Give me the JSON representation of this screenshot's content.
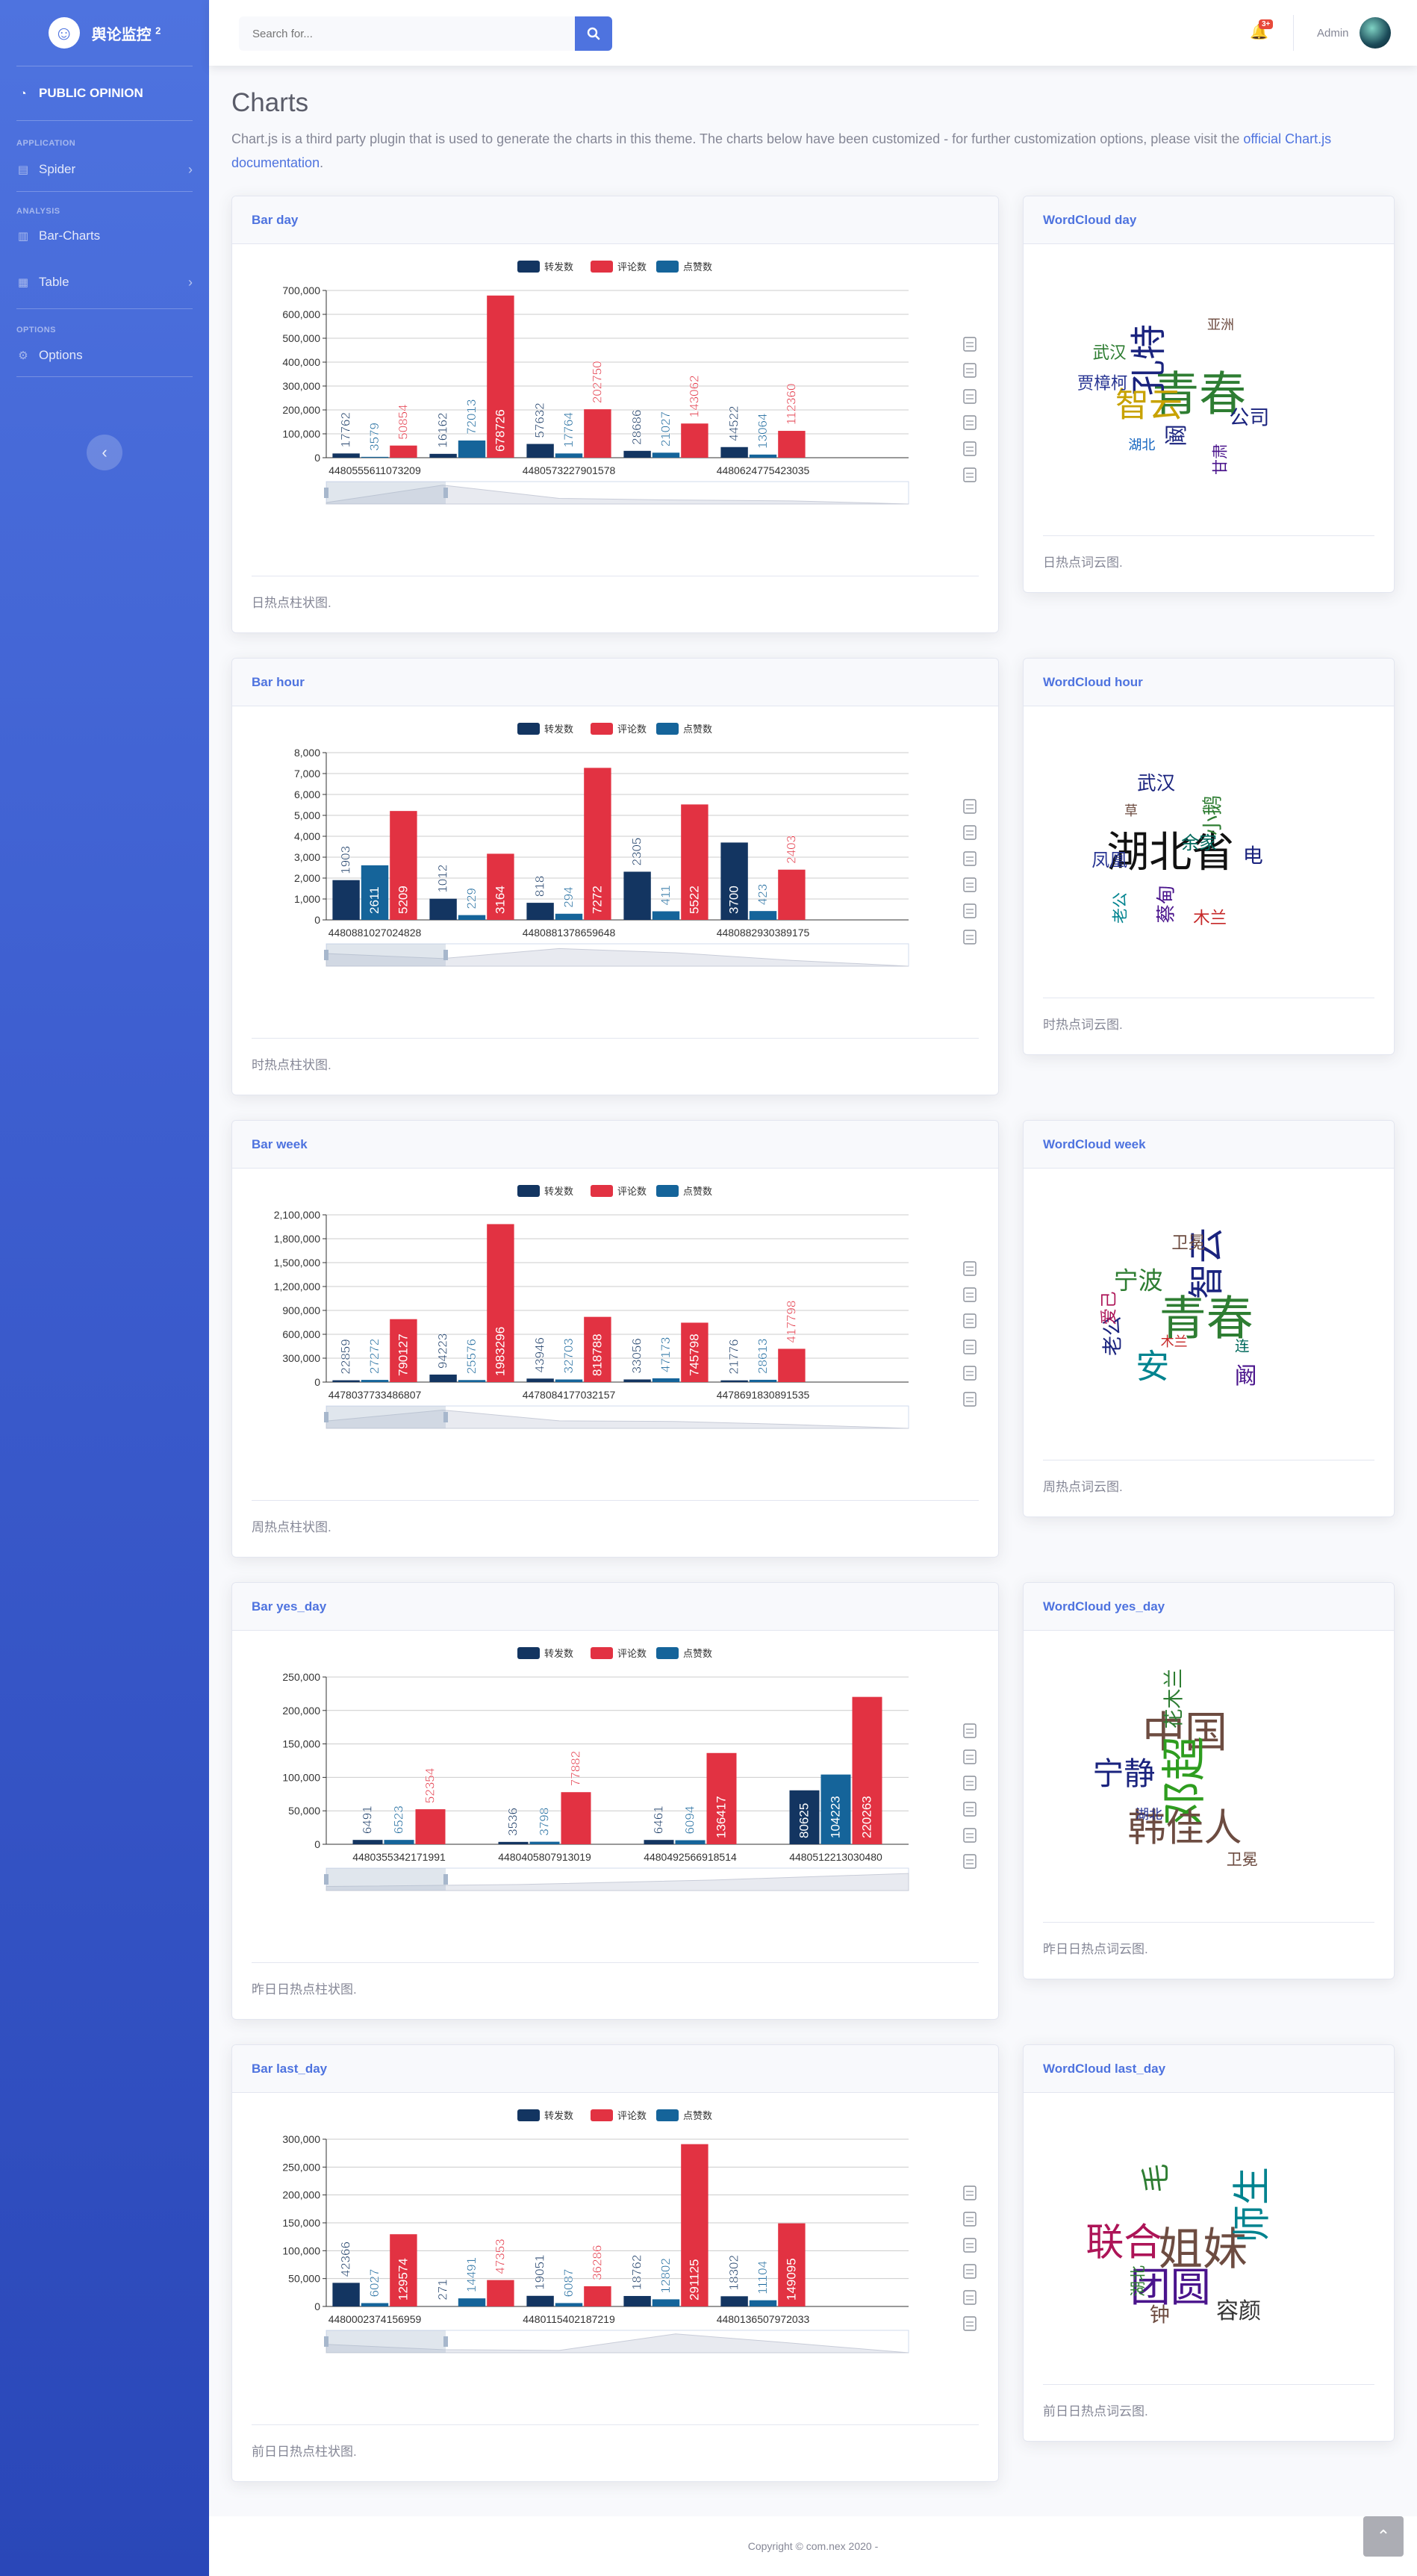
{
  "sidebar": {
    "brand": "舆论监控",
    "brand_sup": "2",
    "dashboard": "PUBLIC OPINION",
    "heading_app": "APPLICATION",
    "spider": "Spider",
    "heading_analysis": "ANALYSIS",
    "bar_charts": "Bar-Charts",
    "table": "Table",
    "heading_options": "OPTIONS",
    "options": "Options",
    "toggle_glyph": "‹"
  },
  "topbar": {
    "search_placeholder": "Search for...",
    "alert_count": "3+",
    "user_name": "Admin"
  },
  "page": {
    "title": "Charts",
    "desc_text": "Chart.js is a third party plugin that is used to generate the charts in this theme. The charts below have been customized - for further customization options, please visit the ",
    "desc_link": "official Chart.js documentation",
    "desc_end": "."
  },
  "legend": [
    "转发数",
    "评论数",
    "点赞数"
  ],
  "colors": {
    "forward": "#133561",
    "comment": "#e23242",
    "like": "#15649a",
    "primary": "#4e73df"
  },
  "toolbox_icons": [
    "data-view-icon",
    "line-chart-icon",
    "bar-chart-icon",
    "stack-icon",
    "restore-icon",
    "save-image-icon"
  ],
  "chart_data": [
    {
      "id": "day",
      "type": "bar",
      "title": "Bar day",
      "caption": "日热点柱状图.",
      "series_names": [
        "转发数",
        "评论数",
        "点赞数"
      ],
      "ylim": [
        0,
        700000
      ],
      "yticks": [
        "0",
        "100,000",
        "200,000",
        "300,000",
        "400,000",
        "500,000",
        "600,000",
        "700,000"
      ],
      "categories": [
        "4480555611073209",
        "",
        "4480573227901578",
        "",
        "4480624775423035",
        ""
      ],
      "series": [
        {
          "name": "转发数",
          "values": [
            17762,
            16162,
            57632,
            28686,
            44522,
            0
          ]
        },
        {
          "name": "点赞数",
          "values": [
            3579,
            72013,
            17764,
            21027,
            13064,
            0
          ]
        },
        {
          "name": "评论数",
          "values": [
            50854,
            678726,
            202750,
            143062,
            112360,
            0
          ]
        }
      ]
    },
    {
      "id": "hour",
      "type": "bar",
      "title": "Bar hour",
      "caption": "时热点柱状图.",
      "series_names": [
        "转发数",
        "评论数",
        "点赞数"
      ],
      "ylim": [
        0,
        8000
      ],
      "yticks": [
        "0",
        "1,000",
        "2,000",
        "3,000",
        "4,000",
        "5,000",
        "6,000",
        "7,000",
        "8,000"
      ],
      "categories": [
        "4480881027024828",
        "",
        "4480881378659648",
        "",
        "4480882930389175",
        ""
      ],
      "series": [
        {
          "name": "转发数",
          "values": [
            1903,
            1012,
            818,
            2305,
            3700,
            0
          ]
        },
        {
          "name": "点赞数",
          "values": [
            2611,
            229,
            294,
            411,
            423,
            0
          ]
        },
        {
          "name": "评论数",
          "values": [
            5209,
            3164,
            7272,
            5522,
            2403,
            0
          ]
        }
      ]
    },
    {
      "id": "week",
      "type": "bar",
      "title": "Bar week",
      "caption": "周热点柱状图.",
      "series_names": [
        "转发数",
        "评论数",
        "点赞数"
      ],
      "ylim": [
        0,
        2100000
      ],
      "yticks": [
        "0",
        "300,000",
        "600,000",
        "900,000",
        "1,200,000",
        "1,500,000",
        "1,800,000",
        "2,100,000"
      ],
      "categories": [
        "4478037733486807",
        "",
        "4478084177032157",
        "",
        "4478691830891535",
        ""
      ],
      "series": [
        {
          "name": "转发数",
          "values": [
            22859,
            94223,
            43946,
            33056,
            21776,
            0
          ]
        },
        {
          "name": "点赞数",
          "values": [
            27272,
            25576,
            32703,
            47173,
            28613,
            0
          ]
        },
        {
          "name": "评论数",
          "values": [
            790127,
            1983296,
            818788,
            745798,
            417798,
            0
          ]
        }
      ]
    },
    {
      "id": "yes_day",
      "type": "bar",
      "title": "Bar yes_day",
      "caption": "昨日日热点柱状图.",
      "series_names": [
        "转发数",
        "评论数",
        "点赞数"
      ],
      "ylim": [
        0,
        250000
      ],
      "yticks": [
        "0",
        "50,000",
        "100,000",
        "150,000",
        "200,000",
        "250,000"
      ],
      "categories": [
        "4480355342171991",
        "4480405807913019",
        "4480492566918514",
        "4480512213030480"
      ],
      "series": [
        {
          "name": "转发数",
          "values": [
            6491,
            3536,
            6461,
            80625
          ]
        },
        {
          "name": "点赞数",
          "values": [
            6523,
            3798,
            6094,
            104223
          ]
        },
        {
          "name": "评论数",
          "values": [
            52354,
            77882,
            136417,
            220263
          ]
        }
      ]
    },
    {
      "id": "last_day",
      "type": "bar",
      "title": "Bar last_day",
      "caption": "前日日热点柱状图.",
      "series_names": [
        "转发数",
        "评论数",
        "点赞数"
      ],
      "ylim": [
        0,
        300000
      ],
      "yticks": [
        "0",
        "50,000",
        "100,000",
        "150,000",
        "200,000",
        "250,000",
        "300,000"
      ],
      "categories": [
        "4480002374156959",
        "",
        "4480115402187219",
        "",
        "4480136507972033",
        ""
      ],
      "series": [
        {
          "name": "转发数",
          "values": [
            42366,
            271,
            19051,
            18762,
            18302,
            0
          ]
        },
        {
          "name": "点赞数",
          "values": [
            6027,
            14491,
            6087,
            12802,
            11104,
            0
          ]
        },
        {
          "name": "评论数",
          "values": [
            129574,
            47353,
            36286,
            291125,
            149095,
            0
          ]
        }
      ]
    }
  ],
  "wordclouds": [
    {
      "id": "day",
      "title": "WordCloud day",
      "caption": "日热点词云图.",
      "words": [
        {
          "t": "青春",
          "c": "#2e7d32"
        },
        {
          "t": "孔特",
          "c": "#1a237e"
        },
        {
          "t": "智云",
          "c": "#c8a200"
        },
        {
          "t": "公司",
          "c": "#1a237e"
        },
        {
          "t": "阚",
          "c": "#1a237e"
        },
        {
          "t": "武汉",
          "c": "#2e7d32"
        },
        {
          "t": "贾樟柯",
          "c": "#283593"
        },
        {
          "t": "甘肃",
          "c": "#4a148c"
        },
        {
          "t": "湖北",
          "c": "#1565c0"
        },
        {
          "t": "亚洲",
          "c": "#6d4c41"
        }
      ]
    },
    {
      "id": "hour",
      "title": "WordCloud hour",
      "caption": "时热点词云图.",
      "words": [
        {
          "t": "湖北省",
          "c": "#111111"
        },
        {
          "t": "小鹅",
          "c": "#2e7d32"
        },
        {
          "t": "武汉",
          "c": "#1a237e"
        },
        {
          "t": "余家",
          "c": "#00695c"
        },
        {
          "t": "蔡甸",
          "c": "#4a148c"
        },
        {
          "t": "木兰",
          "c": "#c62828"
        },
        {
          "t": "凤凰",
          "c": "#283593"
        },
        {
          "t": "老公",
          "c": "#00838f"
        },
        {
          "t": "电",
          "c": "#1a237e"
        },
        {
          "t": "草",
          "c": "#6d4c41"
        }
      ]
    },
    {
      "id": "week",
      "title": "WordCloud week",
      "caption": "周热点词云图.",
      "words": [
        {
          "t": "青春",
          "c": "#2e7d32"
        },
        {
          "t": "智云",
          "c": "#1a237e"
        },
        {
          "t": "安",
          "c": "#00838f"
        },
        {
          "t": "宁波",
          "c": "#2e7d32"
        },
        {
          "t": "老公",
          "c": "#1a237e"
        },
        {
          "t": "阚",
          "c": "#4a148c"
        },
        {
          "t": "卫冕",
          "c": "#6d4c41"
        },
        {
          "t": "爱己",
          "c": "#ad1457"
        },
        {
          "t": "连",
          "c": "#00695c"
        },
        {
          "t": "木兰",
          "c": "#c62828"
        }
      ]
    },
    {
      "id": "yes_day",
      "title": "WordCloud yes_day",
      "caption": "昨日日热点词云图.",
      "words": [
        {
          "t": "中国",
          "c": "#6d4c41"
        },
        {
          "t": "邓超",
          "c": "#2e9d1f"
        },
        {
          "t": "韩佳人",
          "c": "#6d4c41"
        },
        {
          "t": "宁静",
          "c": "#1a237e"
        },
        {
          "t": "花木兰",
          "c": "#2e7d32"
        },
        {
          "t": "卫冕",
          "c": "#6d4c41"
        },
        {
          "t": "湖北",
          "c": "#283593"
        }
      ]
    },
    {
      "id": "last_day",
      "title": "WordCloud last_day",
      "caption": "前日日热点词云图.",
      "words": [
        {
          "t": "姐妹",
          "c": "#6d4c41"
        },
        {
          "t": "师生",
          "c": "#00838f"
        },
        {
          "t": "团圆",
          "c": "#4a148c"
        },
        {
          "t": "联合",
          "c": "#ad1457"
        },
        {
          "t": "毛",
          "c": "#2e7d32"
        },
        {
          "t": "容颜",
          "c": "#333333"
        },
        {
          "t": "钟",
          "c": "#6d4c41"
        },
        {
          "t": "湖北",
          "c": "#2e7d32"
        }
      ]
    }
  ],
  "footer": {
    "copyright": "Copyright © com.nex 2020 -"
  }
}
